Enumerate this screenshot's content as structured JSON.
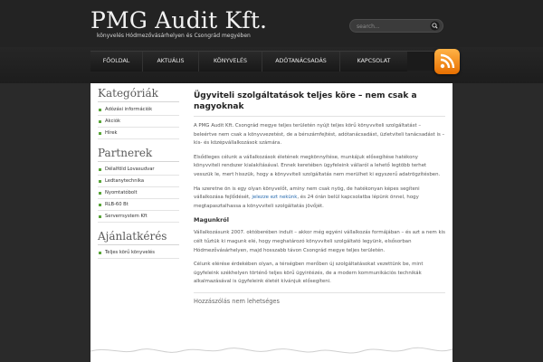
{
  "header": {
    "title": "PMG Audit Kft.",
    "description": "könyvelés Hódmezővásárhelyen és Csongrád megyében",
    "search_placeholder": "search..."
  },
  "nav": {
    "items": [
      {
        "label": "FŐOLDAL"
      },
      {
        "label": "AKTUÁLIS"
      },
      {
        "label": "KÖNYVELÉS"
      },
      {
        "label": "ADÓTANÁCSADÁS"
      },
      {
        "label": "KAPCSOLAT"
      }
    ]
  },
  "sidebar": {
    "categories": {
      "title": "Kategóriák",
      "items": [
        {
          "label": "Adózási információk"
        },
        {
          "label": "Akciók"
        },
        {
          "label": "Hírek"
        }
      ]
    },
    "partners": {
      "title": "Partnerek",
      "items": [
        {
          "label": "Délalföld Lovasudvar"
        },
        {
          "label": "Ledtanytechnika"
        },
        {
          "label": "Nyomtatóbolt"
        },
        {
          "label": "RLB-60 Bt"
        },
        {
          "label": "Serverrsystem Kft"
        }
      ]
    },
    "offers": {
      "title": "Ajánlatkérés",
      "items": [
        {
          "label": "Teljes körű könyvelés"
        }
      ]
    }
  },
  "main": {
    "title": "Ügyviteli szolgáltatások teljes köre – nem csak a nagyoknak",
    "p1": "A PMG Audit Kft. Csongrád megye teljes területén nyújt teljes körű könyvviteli szolgáltatást – beleértve nem csak a könyvvezetést, de a bérszámfejtést, adótanácsadást, üzletviteli tanácsadást is – kis- és középvállalkozások számára.",
    "p2": "Elsődleges célunk a vállalkozások életének megkönnyítése, munkájuk elősegítése hatékony könyvviteli rendszer kialakításával. Ennek keretében ügyfeleink vállaról a lehető legtöbb terhet vesszük le, mert hisszük, hogy a könyvviteli szolgáltatás nem merülhet ki egyszerű adatrögzítésben.",
    "p3_before": "Ha szeretne ön is egy olyan könyvelőt, aminy nem csak nyög, de hatékonyan képes segíteni vállalkozása fejlődését, ",
    "p3_link": "jelezze ezt nekünk",
    "p3_after": ", és 24 órán belül kapcsolatba lépünk önnel, hogy megtapasztalhassa a könyvviteli szolgáltatás jövőjét.",
    "subhead": "Magunkról",
    "p4": "Vállalkozásunk 2007. októberében indult – akkor még egyéni vállalkozás formájában – és azt a nem kis célt tűztük ki magunk elé, hogy meghatározó könyvviteli szolgáltató legyünk, elsősorban Hódmezővásárhelyen, majd hosszabb távon Csongrád megye teljes területén.",
    "p5": "Célunk elérése érdekében olyan, a térségben merőben új szolgáltatásokat vezettünk be, mint ügyfeleink székhelyen történő teljes körű ügyintézés, de a modern kommunikációs technikák alkalmazásával is ügyfeleink életét kívánjuk elősegíteni.",
    "comments": "Hozzászólás nem lehetséges"
  },
  "icons": {
    "search": "search-icon",
    "rss": "rss-icon",
    "bullet": "square-bullet-icon"
  },
  "colors": {
    "accent_green": "#5aa53a",
    "rss_orange": "#f08a13",
    "link_blue": "#2a6db0"
  }
}
